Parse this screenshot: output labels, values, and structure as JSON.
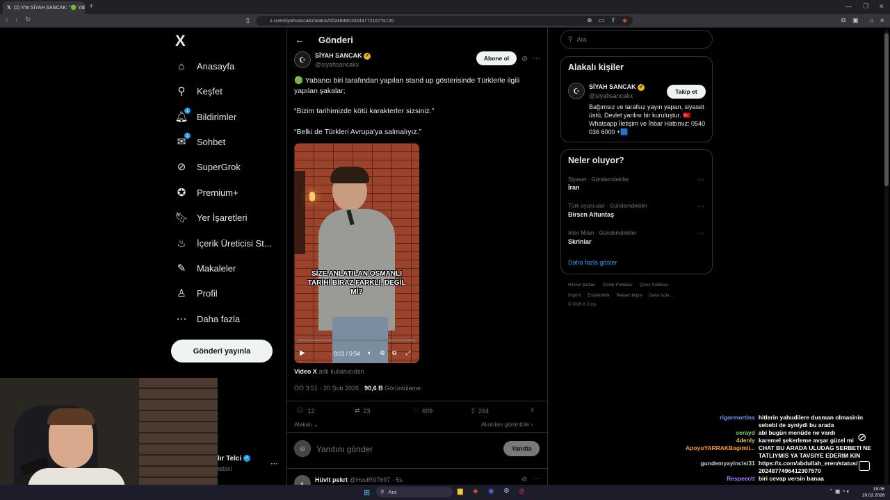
{
  "browser": {
    "tab_title": "(2) X'te SİYAH SANCAK: \"🟢 Yab...",
    "url": "x.com/siyahsancakx/status/2024648010244772157?s=20"
  },
  "sidebar": {
    "logo": "X",
    "items": [
      {
        "label": "Anasayfa",
        "icon": "home-icon"
      },
      {
        "label": "Keşfet",
        "icon": "search-icon"
      },
      {
        "label": "Bildirimler",
        "icon": "bell-icon",
        "badge": "1"
      },
      {
        "label": "Sohbet",
        "icon": "mail-icon",
        "badge": "1"
      },
      {
        "label": "SuperGrok",
        "icon": "grok-icon"
      },
      {
        "label": "Premium+",
        "icon": "premium-icon"
      },
      {
        "label": "Yer İşaretleri",
        "icon": "bookmark-icon"
      },
      {
        "label": "İçerik Üreticisi St...",
        "icon": "creator-icon"
      },
      {
        "label": "Makaleler",
        "icon": "article-icon"
      },
      {
        "label": "Profil",
        "icon": "profile-icon"
      },
      {
        "label": "Daha fazla",
        "icon": "more-icon"
      }
    ],
    "post_button": "Gönderi yayınla",
    "account_name": "lır Telci",
    "account_handle": "lebixi"
  },
  "post": {
    "header_title": "Gönderi",
    "author_name": "SİYAH SANCAK",
    "author_handle": "@siyahsancakx",
    "subscribe_button": "Abone ol",
    "text_1": "🟢 Yabancı biri tarafından yapılan stand up gösterisinde Türklerle ilgili yapılan şakalar;",
    "text_2": "“Bizim tarihimizde kötü karakterler sizsiniz.”",
    "text_3": "“Belki de Türkleri Avrupa'ya salmalıyız.”",
    "video_caption": "SİZE ANLATILAN OSMANLI TARİHİ BİRAZ FARKLI, DEĞİL Mİ?",
    "video_time": "0:01 / 0:54",
    "video_source_bold": "Video X",
    "video_source_rest": "adlı kullanıcıdan",
    "timestamp": "ÖÖ 3:51 · 20 Şub 2026 ·",
    "views": "90,6 B",
    "views_label": "Görüntüleme",
    "replies": "12",
    "reposts": "23",
    "likes": "609",
    "bookmarks": "264",
    "related_label": "Alakalı",
    "quotes_label": "Alıntıları görüntüle",
    "reply_placeholder": "Yanıtını gönder",
    "reply_button": "Yanıtla",
    "next_reply_name": "Hüvlt pekrt",
    "next_reply_handle": "@HuvlR97697 · 5s"
  },
  "right": {
    "search_placeholder": "Ara",
    "related_title": "Alakalı kişiler",
    "person_name": "SİYAH SANCAK",
    "person_handle": "@siyahsancakx",
    "follow_button": "Takip et",
    "person_bio": "Bağımsız ve tarafsız yayın yapan, siyaset üstü, Devlet yanlısı bir kuruluştur. 🇹🇷 Whatsapp İletişim ve İhbar Hattımız: 0540 036 6000 +🟦",
    "trends_title": "Neler oluyor?",
    "trends": [
      {
        "context": "Siyaset · Gündemdekiler",
        "name": "İran"
      },
      {
        "context": "Türk oyuncular · Gündemdekiler",
        "name": "Birsen Altuntaş"
      },
      {
        "context": "Inter Milan · Gündemdekiler",
        "name": "Skriniar"
      }
    ],
    "show_more": "Daha fazla göster",
    "footer_1": [
      "Hizmet Şartları",
      "Gizlilik Politikası",
      "Çerez Politikası"
    ],
    "footer_2": [
      "Imprint",
      "Erişilebilirlik",
      "Reklam bilgisi",
      "Daha fazla ..."
    ],
    "copyright": "© 2026 X Corp."
  },
  "chat": [
    {
      "user": "rigormortins",
      "color": "#6fa0ff",
      "text": "hitlerin yahudilere dusman olmasinin"
    },
    {
      "user": "",
      "color": "#ffffff",
      "text": "sebebi de ayniydi bu arada"
    },
    {
      "user": "serayd",
      "color": "#7ad97a",
      "text": "abi bugün menüde ne vardı"
    },
    {
      "user": "4denly",
      "color": "#e0c04a",
      "text": "karemel şekerleme avşar güzel mi"
    },
    {
      "user": "ApoyuYARRAKBagimli...",
      "color": "#ff9a2e",
      "text": "CHAT BU ARADA ULUDAG SERBETI NE"
    },
    {
      "user": "",
      "color": "#ffffff",
      "text": "TATLIYMIS YA TAVSIYE EDERIM KIN"
    },
    {
      "user": "gundemyayincisi31",
      "color": "#cfcfcf",
      "text": "https://x.com/abdullah_eren/status/"
    },
    {
      "user": "",
      "color": "#ffffff",
      "text": "2024877496412307570"
    },
    {
      "user": "Respeectt",
      "color": "#b07cff",
      "text": "biri cevap versin banaa"
    }
  ],
  "taskbar": {
    "search": "Ara",
    "time": "19:06",
    "date": "20.02.2026"
  }
}
